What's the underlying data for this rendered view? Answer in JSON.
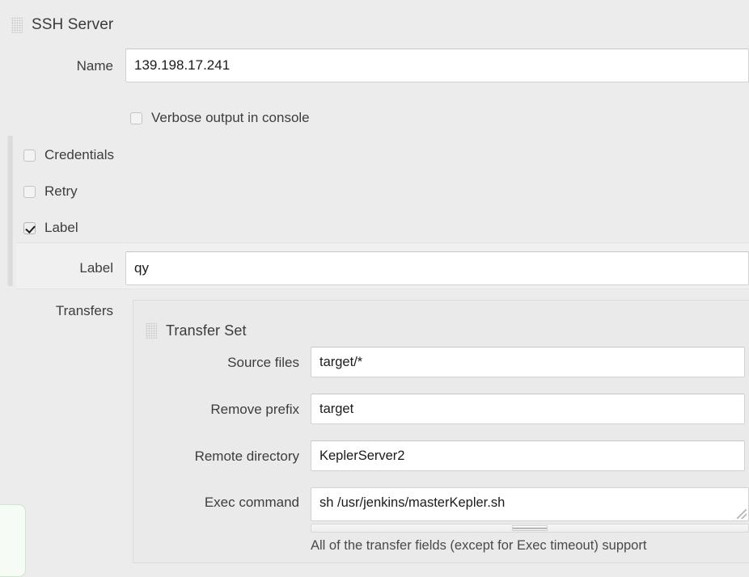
{
  "section": {
    "title": "SSH Server",
    "drag_handle_icon": "drag-grid-icon"
  },
  "fields": {
    "name": {
      "label": "Name",
      "value": "139.198.17.241"
    },
    "label_field": {
      "label": "Label",
      "value": "qy"
    },
    "transfers": {
      "label": "Transfers"
    }
  },
  "checkboxes": [
    {
      "name": "verbose-output",
      "label": "Verbose output in console",
      "checked": false
    },
    {
      "name": "credentials",
      "label": "Credentials",
      "checked": false
    },
    {
      "name": "retry",
      "label": "Retry",
      "checked": false
    },
    {
      "name": "label",
      "label": "Label",
      "checked": true
    }
  ],
  "transfer_set": {
    "title": "Transfer Set",
    "drag_handle_icon": "drag-grid-icon",
    "fields": [
      {
        "name": "source-files",
        "label": "Source files",
        "value": "target/*"
      },
      {
        "name": "remove-prefix",
        "label": "Remove prefix",
        "value": "target"
      },
      {
        "name": "remote-directory",
        "label": "Remote directory",
        "value": "KeplerServer2"
      },
      {
        "name": "exec-command",
        "label": "Exec command",
        "value": "sh /usr/jenkins/masterKepler.sh"
      }
    ],
    "help_text": "All of the transfer fields (except for Exec timeout) support"
  },
  "colors": {
    "page_background": "#ececec",
    "panel_background": "#eaeaea",
    "input_background": "#ffffff",
    "input_border": "#d2d2d2",
    "text": "#333333",
    "validation_green": "#cfe6cf"
  }
}
